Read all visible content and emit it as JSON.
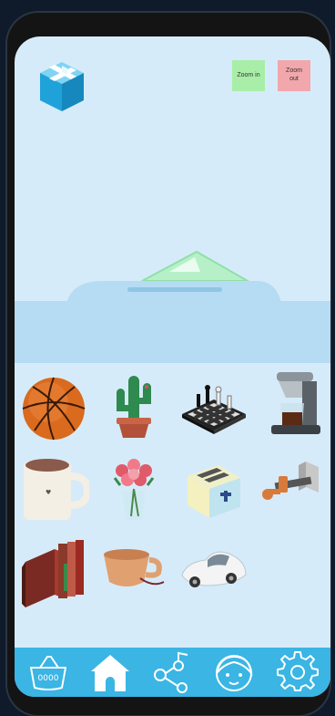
{
  "toolbar": {
    "zoom_in_label": "Zoom in",
    "zoom_out_label": "Zoom out"
  },
  "items": [
    {
      "icon": "basketball-icon"
    },
    {
      "icon": "cactus-icon"
    },
    {
      "icon": "chess-board-icon"
    },
    {
      "icon": "coffee-maker-icon"
    },
    {
      "icon": "mug-icon"
    },
    {
      "icon": "flower-bouquet-icon"
    },
    {
      "icon": "toaster-icon"
    },
    {
      "icon": "clamp-icon"
    },
    {
      "icon": "books-icon"
    },
    {
      "icon": "cup-icon"
    },
    {
      "icon": "car-icon"
    }
  ],
  "tabs": [
    {
      "icon": "basket-icon",
      "active": false
    },
    {
      "icon": "home-icon",
      "active": true
    },
    {
      "icon": "share-icon",
      "active": false
    },
    {
      "icon": "avatar-icon",
      "active": false
    },
    {
      "icon": "gear-icon",
      "active": false
    }
  ],
  "colors": {
    "screen_bg": "#d6ebf9",
    "tab_bar": "#3ab5e4",
    "zoom_in": "#a8eea8",
    "zoom_out": "#f2a7ac"
  }
}
